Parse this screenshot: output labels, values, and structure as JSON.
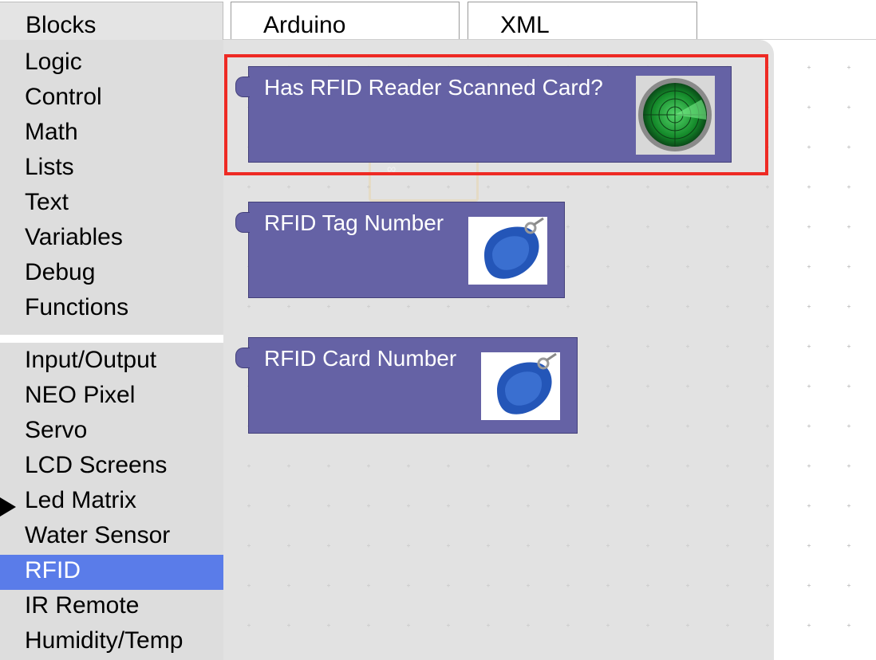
{
  "tabs": {
    "blocks": "Blocks",
    "arduino": "Arduino",
    "xml": "XML"
  },
  "toolbox": {
    "categories": [
      "Logic",
      "Control",
      "Math",
      "Lists",
      "Text",
      "Variables",
      "Debug",
      "Functions",
      "Input/Output",
      "NEO Pixel",
      "Servo",
      "LCD Screens",
      "Led Matrix",
      "Water Sensor",
      "RFID",
      "IR Remote",
      "Humidity/Temp"
    ],
    "selected": "RFID",
    "selected_color": "#5a7ce9"
  },
  "flyout": {
    "blocks": [
      {
        "label": "Has RFID Reader Scanned Card?",
        "image": "radar-icon"
      },
      {
        "label": "RFID Tag Number",
        "image": "rfid-keyfob-icon"
      },
      {
        "label": "RFID Card Number",
        "image": "rfid-keyfob-icon"
      }
    ],
    "block_color": "#6562a5",
    "highlight_color": "#ee2a24"
  }
}
